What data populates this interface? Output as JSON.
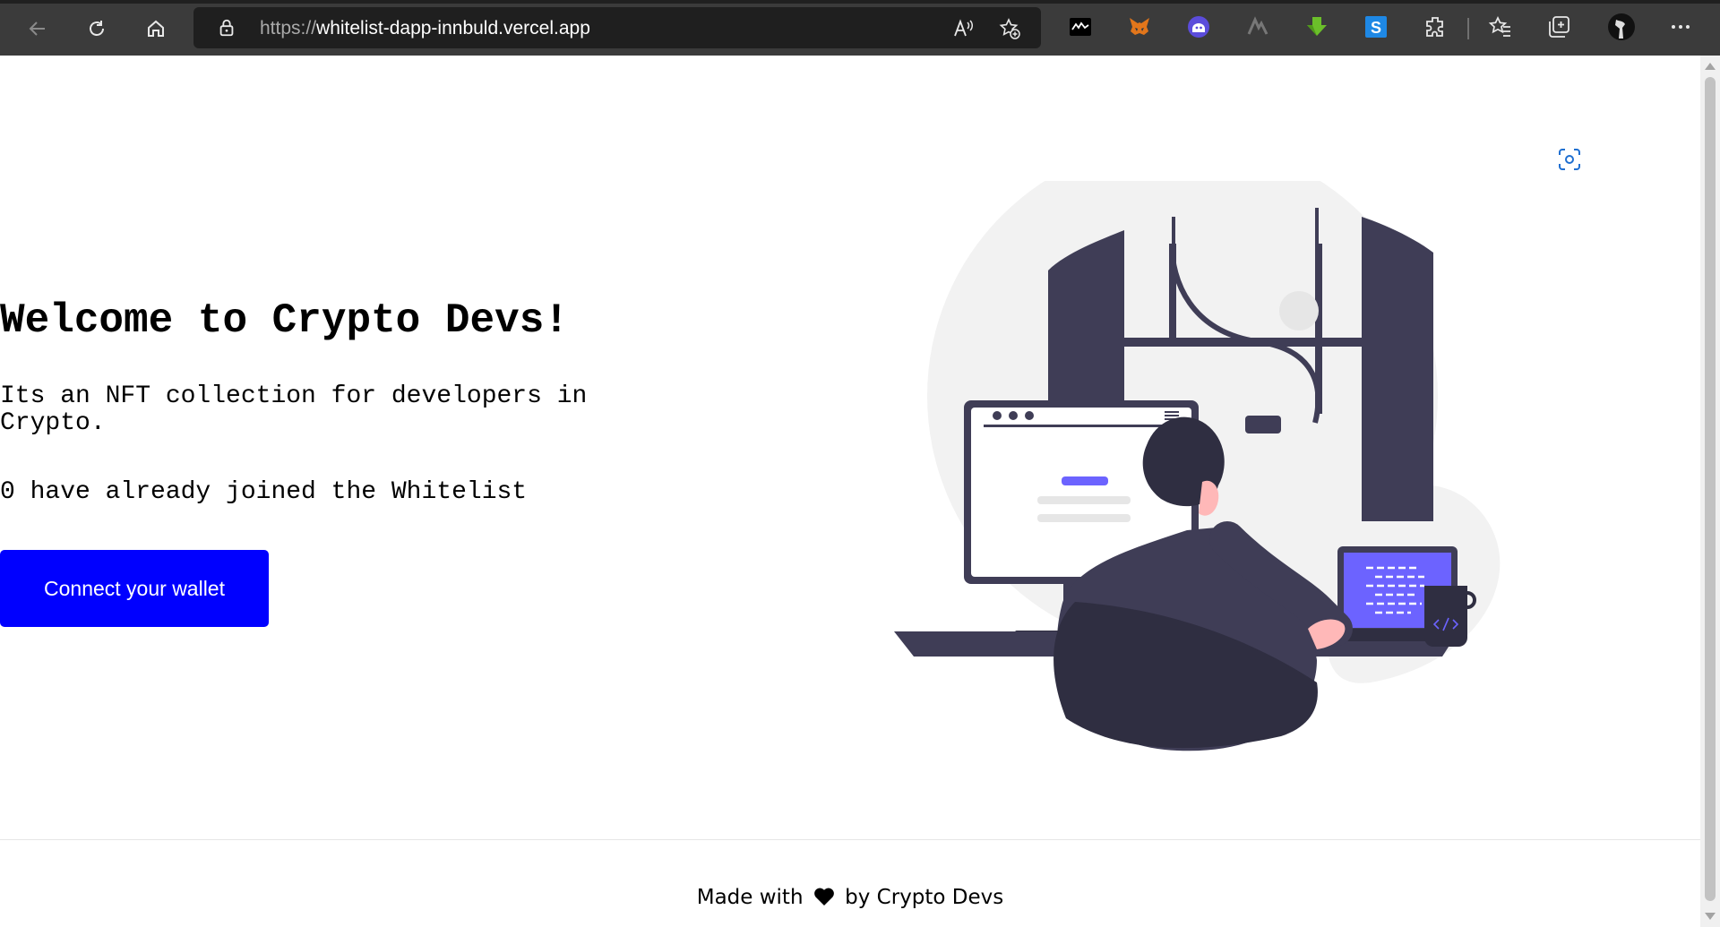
{
  "browser": {
    "url_protocol": "https://",
    "url_host": "whitelist-dapp-innbuld.vercel.app"
  },
  "page": {
    "title": "Welcome to Crypto Devs!",
    "description": "Its an NFT collection for developers in Crypto.",
    "joined_text": "0 have already joined the Whitelist",
    "connect_button": "Connect your wallet",
    "footer_prefix": "Made with",
    "footer_suffix": "by Crypto Devs"
  },
  "colors": {
    "button": "#0000ff",
    "accent_purple": "#6c63ff",
    "illustration_dark": "#3f3d56",
    "skin": "#ffb8b8"
  },
  "icons": [
    "back-icon",
    "refresh-icon",
    "home-icon",
    "lock-icon",
    "read-aloud-icon",
    "add-favorite-icon",
    "extensions-icon",
    "favorites-icon",
    "collections-icon",
    "profile-avatar",
    "more-icon",
    "heart-icon"
  ]
}
